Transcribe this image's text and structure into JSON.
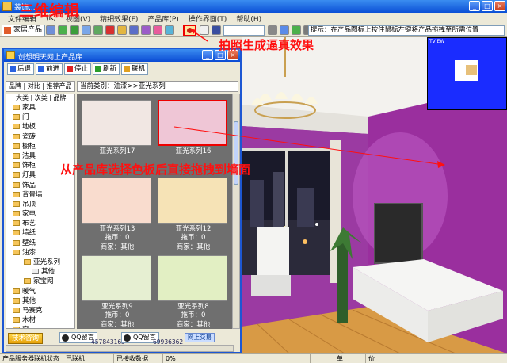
{
  "window": {
    "title": "装饰..."
  },
  "menu": [
    "文件编辑",
    "(K)",
    "视图(V)",
    "精细效果(F)",
    "产品库(P)",
    "操作界面(T)",
    "帮助(H)"
  ],
  "toolbar": {
    "home_label": "家居产品",
    "hint": "提示：在产品图标上按住鼠标左键将产品拖拽至所需位置"
  },
  "minimap": {
    "label": "TVIEW"
  },
  "library": {
    "title": "创想明天网上产品库",
    "tools": [
      "后退",
      "前进",
      "停止",
      "刷新",
      "联机"
    ],
    "tabs": "品牌 | 对比 | 推荐产品",
    "category_path": "当前类别：油漆>>亚光系列",
    "tree_header": "大类 | 次类 | 品牌",
    "tree": [
      {
        "label": "家具",
        "level": 0
      },
      {
        "label": "门",
        "level": 0
      },
      {
        "label": "地板",
        "level": 0
      },
      {
        "label": "瓷砖",
        "level": 0
      },
      {
        "label": "橱柜",
        "level": 0
      },
      {
        "label": "洁具",
        "level": 0
      },
      {
        "label": "饰柜",
        "level": 0
      },
      {
        "label": "灯具",
        "level": 0
      },
      {
        "label": "饰品",
        "level": 0
      },
      {
        "label": "背景墙",
        "level": 0
      },
      {
        "label": "吊顶",
        "level": 0
      },
      {
        "label": "家电",
        "level": 0
      },
      {
        "label": "布艺",
        "level": 0
      },
      {
        "label": "墙纸",
        "level": 0
      },
      {
        "label": "壁纸",
        "level": 0
      },
      {
        "label": "油漆",
        "level": 0
      },
      {
        "label": "亚光系列",
        "level": 1
      },
      {
        "label": "其他",
        "level": 2
      },
      {
        "label": "家宝网",
        "level": 1
      },
      {
        "label": "暖气",
        "level": 0
      },
      {
        "label": "其他",
        "level": 0
      },
      {
        "label": "马赛克",
        "level": 0
      },
      {
        "label": "木材",
        "level": 0
      },
      {
        "label": "窗",
        "level": 0
      }
    ],
    "products": [
      {
        "name": "亚光系列17",
        "price": "",
        "brand": "",
        "color": "#f1e7e3",
        "selected": false
      },
      {
        "name": "亚光系列16",
        "price": "",
        "brand": "",
        "color": "#efc6d6",
        "selected": true
      },
      {
        "name": "亚光系列13",
        "price": "拖币：0",
        "brand": "商家：其他",
        "color": "#f9dcce",
        "selected": false
      },
      {
        "name": "亚光系列12",
        "price": "拖币：0",
        "brand": "商家：其他",
        "color": "#f6e3b6",
        "selected": false
      },
      {
        "name": "亚光系列9",
        "price": "拖币：0",
        "brand": "商家：其他",
        "color": "#e6efd2",
        "selected": false
      },
      {
        "name": "亚光系列8",
        "price": "拖币：0",
        "brand": "商家：其他",
        "color": "#e2efc3",
        "selected": false
      }
    ],
    "footer": {
      "visit": "技术咨询",
      "qq1": "QQ留言",
      "qq_num1": "457843163",
      "qq2": "QQ留言",
      "qq_num2": "69936362",
      "mall": "网上交易"
    }
  },
  "status": [
    "产品服务器联机状态",
    "已联机",
    "已接收数据",
    "0%",
    "",
    "单",
    "价"
  ],
  "annotations": {
    "title_note": "三维编辑",
    "photo_note": "拍照生成逼真效果",
    "drag_note": "从产品库选择色板后直接拖拽到墙面"
  },
  "colors": {
    "wall": "#9a2f9e",
    "accent_red": "#ff1010",
    "xp_blue": "#0a4fd6",
    "floor": "#d89a45"
  }
}
